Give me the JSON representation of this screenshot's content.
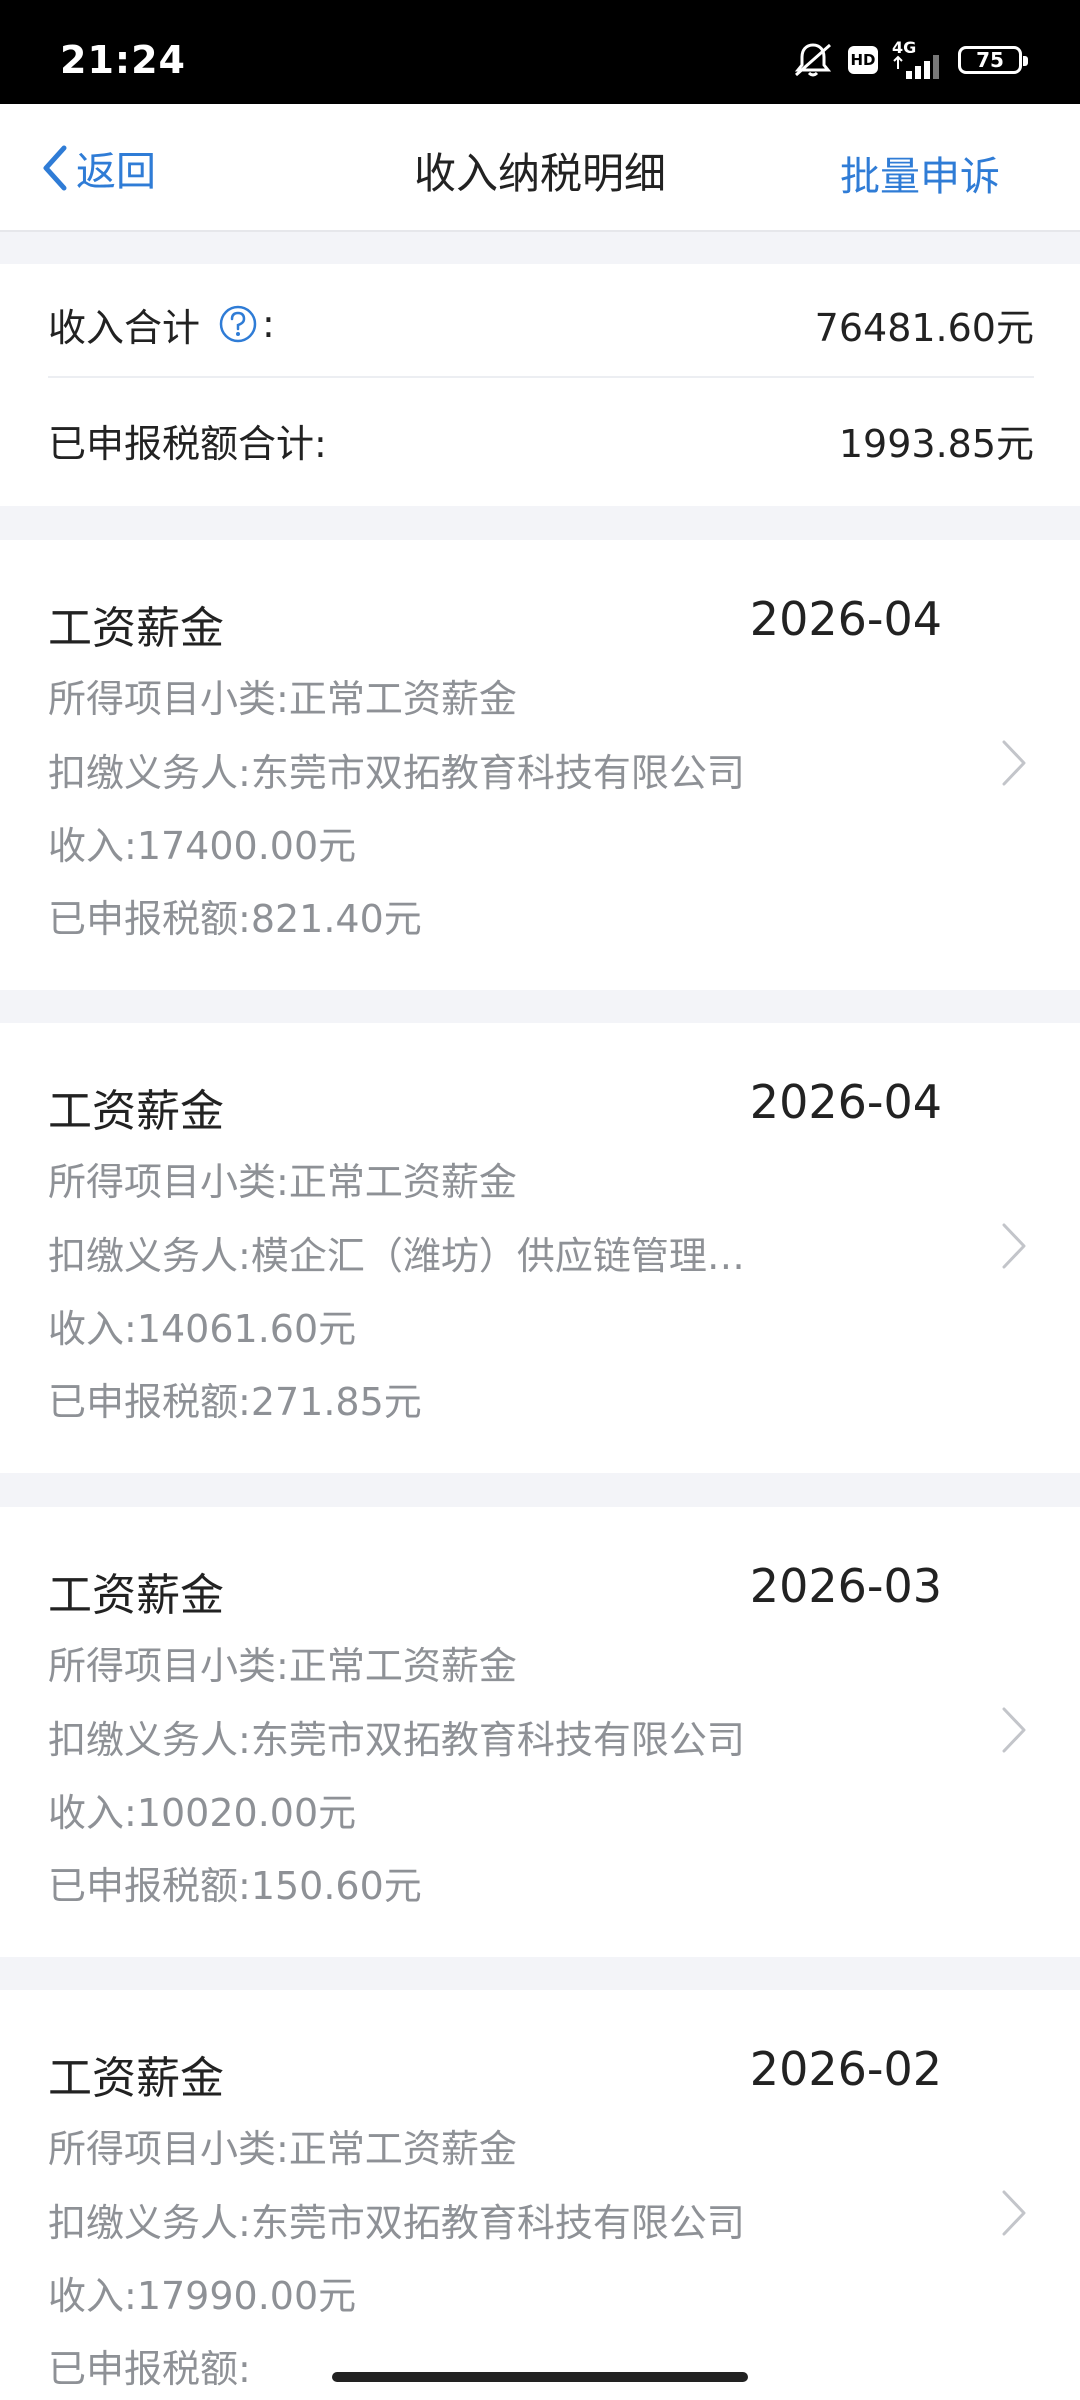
{
  "status": {
    "time": "21:24",
    "hd": "HD",
    "network": "4G",
    "battery": "75"
  },
  "nav": {
    "back_label": "返回",
    "title": "收入纳税明细",
    "action_label": "批量申诉"
  },
  "summary": {
    "income_label": "收入合计",
    "income_suffix": ":",
    "income_value": "76481.60元",
    "tax_label": "已申报税额合计:",
    "tax_value": "1993.85元"
  },
  "records": [
    {
      "title": "工资薪金",
      "period": "2026-04",
      "subcategory_label": "所得项目小类:",
      "subcategory": "正常工资薪金",
      "payer_label": "扣缴义务人:",
      "payer": "东莞市双拓教育科技有限公司",
      "income_label": "收入:",
      "income": "17400.00元",
      "tax_label": "已申报税额:",
      "tax": "821.40元"
    },
    {
      "title": "工资薪金",
      "period": "2026-04",
      "subcategory_label": "所得项目小类:",
      "subcategory": "正常工资薪金",
      "payer_label": "扣缴义务人:",
      "payer": "模企汇（潍坊）供应链管理…",
      "income_label": "收入:",
      "income": "14061.60元",
      "tax_label": "已申报税额:",
      "tax": "271.85元"
    },
    {
      "title": "工资薪金",
      "period": "2026-03",
      "subcategory_label": "所得项目小类:",
      "subcategory": "正常工资薪金",
      "payer_label": "扣缴义务人:",
      "payer": "东莞市双拓教育科技有限公司",
      "income_label": "收入:",
      "income": "10020.00元",
      "tax_label": "已申报税额:",
      "tax": "150.60元"
    },
    {
      "title": "工资薪金",
      "period": "2026-02",
      "subcategory_label": "所得项目小类:",
      "subcategory": "正常工资薪金",
      "payer_label": "扣缴义务人:",
      "payer": "东莞市双拓教育科技有限公司",
      "income_label": "收入:",
      "income": "17990.00元",
      "tax_label": "已申报税额:",
      "tax": ""
    }
  ],
  "colors": {
    "accent": "#2f7cd6",
    "secondary_text": "#8e9196",
    "page_bg": "#f3f4f8"
  },
  "icons": {
    "back": "chevron-left-icon",
    "help": "question-circle-icon",
    "row_arrow": "chevron-right-icon"
  }
}
